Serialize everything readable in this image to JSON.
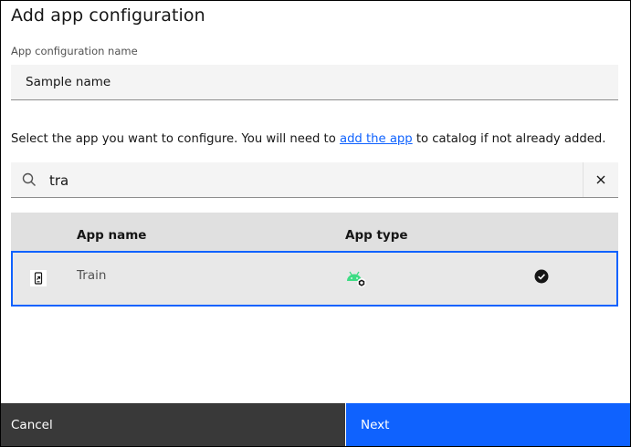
{
  "modal": {
    "title": "Add app configuration"
  },
  "config_name": {
    "label": "App configuration name",
    "value": "Sample name"
  },
  "instructions": {
    "before_link": "Select the app you want to configure. You will need to ",
    "link": "add the app",
    "after_link": " to catalog if not already added."
  },
  "search": {
    "value": "tra",
    "icon": "search-icon",
    "clear_icon": "close-icon"
  },
  "table": {
    "headers": [
      "App name",
      "App type"
    ],
    "rows": [
      {
        "name": "Train",
        "app_icon": "mobile-app-icon",
        "type_icon": "android-icon",
        "selected": true
      }
    ]
  },
  "footer": {
    "cancel_label": "Cancel",
    "next_label": "Next"
  },
  "colors": {
    "primary": "#0f62fe",
    "secondary_button": "#393939",
    "field_background": "#f4f4f4",
    "table_header": "#e0e0e0",
    "android_green": "#3ddc84"
  }
}
